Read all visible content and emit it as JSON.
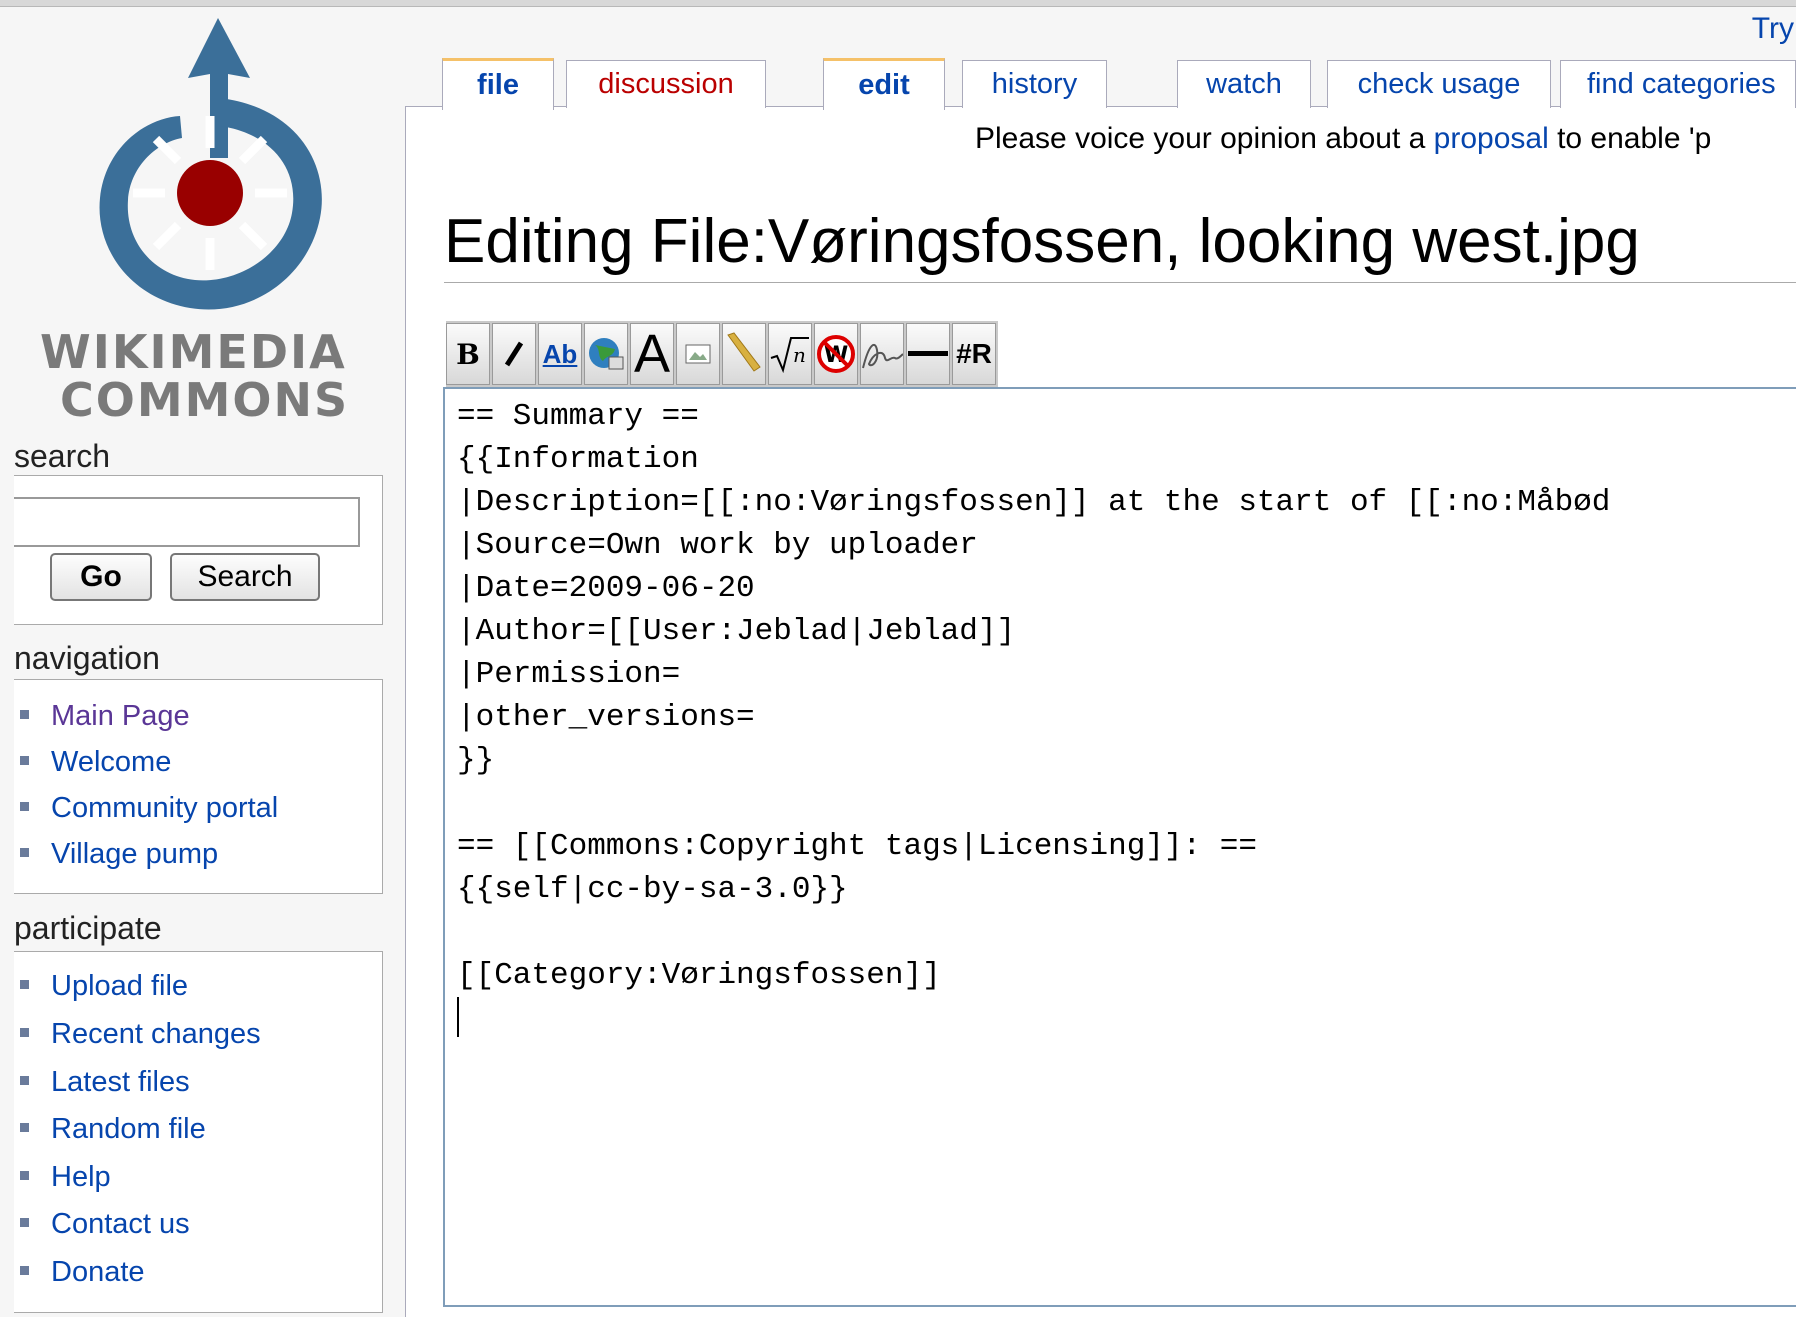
{
  "header": {
    "try_link": "Try"
  },
  "logo": {
    "line1": "WIKIMEDIA",
    "line2": "COMMONS",
    "colors": {
      "blue": "#3b6f99",
      "red": "#990000"
    }
  },
  "search": {
    "title": "search",
    "input_value": "",
    "go_label": "Go",
    "search_label": "Search"
  },
  "navigation": {
    "title": "navigation",
    "items": [
      "Main Page",
      "Welcome",
      "Community portal",
      "Village pump"
    ]
  },
  "participate": {
    "title": "participate",
    "items": [
      "Upload file",
      "Recent changes",
      "Latest files",
      "Random file",
      "Help",
      "Contact us",
      "Donate"
    ]
  },
  "tabs": [
    "file",
    "discussion",
    "edit",
    "history",
    "watch",
    "check usage",
    "find categories"
  ],
  "notice": {
    "before": "Please voice your opinion about a ",
    "link": "proposal",
    "after": " to enable 'p"
  },
  "page_title": "Editing File:Vøringsfossen, looking west.jpg",
  "toolbar": {
    "buttons": [
      "bold-icon",
      "italic-icon",
      "internal-link-icon",
      "external-link-icon",
      "headline-icon",
      "image-icon",
      "media-icon",
      "math-icon",
      "nowiki-icon",
      "signature-icon",
      "horizontal-line-icon",
      "redirect-icon"
    ],
    "redirect_label": "#R",
    "bold_label": "B",
    "internal_link_label": "Ab",
    "headline_label": "A"
  },
  "editor": {
    "lines": [
      "== Summary ==",
      "{{Information",
      "|Description=[[:no:Vøringsfossen]] at the start of [[:no:Måbød",
      "|Source=Own work by uploader",
      "|Date=2009-06-20",
      "|Author=[[User:Jeblad|Jeblad]]",
      "|Permission=",
      "|other_versions=",
      "}}",
      "",
      "== [[Commons:Copyright tags|Licensing]]: ==",
      "{{self|cc-by-sa-3.0}}",
      "",
      "[[Category:Vøringsfossen]]"
    ]
  }
}
